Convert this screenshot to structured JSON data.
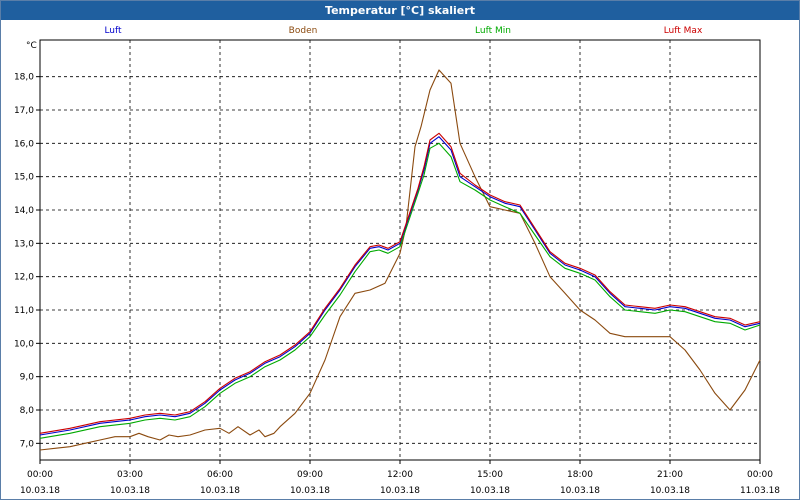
{
  "window": {
    "title": "Temperatur [°C] skaliert"
  },
  "chart_data": {
    "type": "line",
    "unit_label": "°C",
    "title": "Temperatur [°C] skaliert",
    "ylim": [
      6.5,
      19.1
    ],
    "yticks": [
      "7,0",
      "8,0",
      "9,0",
      "10,0",
      "11,0",
      "12,0",
      "13,0",
      "14,0",
      "15,0",
      "16,0",
      "17,0",
      "18,0"
    ],
    "xlim": [
      0,
      24
    ],
    "xticks": [
      {
        "time": "00:00",
        "date": "10.03.18"
      },
      {
        "time": "03:00",
        "date": "10.03.18"
      },
      {
        "time": "06:00",
        "date": "10.03.18"
      },
      {
        "time": "09:00",
        "date": "10.03.18"
      },
      {
        "time": "12:00",
        "date": "10.03.18"
      },
      {
        "time": "15:00",
        "date": "10.03.18"
      },
      {
        "time": "18:00",
        "date": "10.03.18"
      },
      {
        "time": "21:00",
        "date": "10.03.18"
      },
      {
        "time": "00:00",
        "date": "11.03.18"
      }
    ],
    "grid": true,
    "legend_position": "top",
    "series": [
      {
        "name": "Luft",
        "color": "#0000cc",
        "x": [
          0,
          1,
          2,
          3,
          3.5,
          4,
          4.5,
          5,
          5.5,
          6,
          6.5,
          7,
          7.5,
          8,
          8.5,
          9,
          9.5,
          10,
          10.5,
          11,
          11.3,
          11.6,
          12,
          12.3,
          12.6,
          12.8,
          13,
          13.3,
          13.7,
          14,
          14.5,
          15,
          15.5,
          16,
          16.5,
          17,
          17.5,
          18,
          18.5,
          19,
          19.5,
          20,
          20.5,
          21,
          21.5,
          22,
          22.5,
          23,
          23.5,
          24
        ],
        "y": [
          7.25,
          7.4,
          7.6,
          7.7,
          7.8,
          7.85,
          7.8,
          7.9,
          8.2,
          8.6,
          8.9,
          9.1,
          9.4,
          9.6,
          9.9,
          10.3,
          11.0,
          11.6,
          12.3,
          12.85,
          12.9,
          12.8,
          13.0,
          13.8,
          14.6,
          15.2,
          16.0,
          16.2,
          15.8,
          15.0,
          14.7,
          14.4,
          14.2,
          14.1,
          13.4,
          12.7,
          12.35,
          12.2,
          12.0,
          11.5,
          11.1,
          11.05,
          11.0,
          11.1,
          11.05,
          10.9,
          10.75,
          10.7,
          10.5,
          10.6
        ]
      },
      {
        "name": "Boden",
        "color": "#8b4a0f",
        "x": [
          0,
          0.5,
          1,
          1.5,
          2,
          2.5,
          3,
          3.3,
          3.6,
          4,
          4.3,
          4.6,
          5,
          5.5,
          6,
          6.3,
          6.6,
          7,
          7.3,
          7.5,
          7.8,
          8,
          8.5,
          9,
          9.5,
          10,
          10.5,
          11,
          11.5,
          12,
          12.2,
          12.5,
          12.7,
          13,
          13.3,
          13.7,
          14,
          14.5,
          15,
          15.5,
          16,
          16.5,
          17,
          17.5,
          18,
          18.5,
          19,
          19.5,
          20,
          21,
          21.5,
          22,
          22.5,
          23,
          23.5,
          24
        ],
        "y": [
          6.8,
          6.85,
          6.9,
          7.0,
          7.1,
          7.2,
          7.2,
          7.3,
          7.2,
          7.1,
          7.25,
          7.2,
          7.25,
          7.4,
          7.45,
          7.3,
          7.5,
          7.25,
          7.4,
          7.2,
          7.3,
          7.5,
          7.9,
          8.5,
          9.5,
          10.8,
          11.5,
          11.6,
          11.8,
          12.7,
          13.5,
          15.9,
          16.5,
          17.6,
          18.2,
          17.8,
          16.0,
          15.0,
          14.1,
          14.0,
          13.9,
          13.0,
          12.0,
          11.5,
          11.0,
          10.7,
          10.3,
          10.2,
          10.2,
          10.2,
          9.8,
          9.2,
          8.5,
          8.0,
          8.6,
          9.5
        ]
      },
      {
        "name": "Luft Min",
        "color": "#00aa00",
        "x": [
          0,
          1,
          2,
          3,
          3.5,
          4,
          4.5,
          5,
          5.5,
          6,
          6.5,
          7,
          7.5,
          8,
          8.5,
          9,
          9.5,
          10,
          10.5,
          11,
          11.3,
          11.6,
          12,
          12.3,
          12.6,
          12.8,
          13,
          13.3,
          13.7,
          14,
          14.5,
          15,
          15.5,
          16,
          16.5,
          17,
          17.5,
          18,
          18.5,
          19,
          19.5,
          20,
          20.5,
          21,
          21.5,
          22,
          22.5,
          23,
          23.5,
          24
        ],
        "y": [
          7.15,
          7.3,
          7.5,
          7.6,
          7.7,
          7.75,
          7.7,
          7.8,
          8.1,
          8.5,
          8.8,
          9.0,
          9.3,
          9.5,
          9.8,
          10.2,
          10.85,
          11.45,
          12.15,
          12.75,
          12.8,
          12.7,
          12.9,
          13.7,
          14.5,
          15.05,
          15.85,
          16.0,
          15.6,
          14.85,
          14.6,
          14.3,
          14.1,
          13.9,
          13.25,
          12.6,
          12.25,
          12.1,
          11.9,
          11.4,
          11.0,
          10.95,
          10.9,
          11.0,
          10.95,
          10.8,
          10.65,
          10.6,
          10.4,
          10.55
        ]
      },
      {
        "name": "Luft Max",
        "color": "#cc0000",
        "x": [
          0,
          1,
          2,
          3,
          3.5,
          4,
          4.5,
          5,
          5.5,
          6,
          6.5,
          7,
          7.5,
          8,
          8.5,
          9,
          9.5,
          10,
          10.5,
          11,
          11.3,
          11.6,
          12,
          12.3,
          12.6,
          12.8,
          13,
          13.3,
          13.7,
          14,
          14.5,
          15,
          15.5,
          16,
          16.5,
          17,
          17.5,
          18,
          18.5,
          19,
          19.5,
          20,
          20.5,
          21,
          21.5,
          22,
          22.5,
          23,
          23.5,
          24
        ],
        "y": [
          7.3,
          7.45,
          7.65,
          7.75,
          7.85,
          7.9,
          7.85,
          7.95,
          8.25,
          8.65,
          8.95,
          9.15,
          9.45,
          9.65,
          9.95,
          10.35,
          11.05,
          11.65,
          12.35,
          12.9,
          12.95,
          12.85,
          13.05,
          13.85,
          14.65,
          15.3,
          16.1,
          16.3,
          15.9,
          15.1,
          14.75,
          14.45,
          14.25,
          14.15,
          13.45,
          12.75,
          12.4,
          12.25,
          12.05,
          11.55,
          11.15,
          11.1,
          11.05,
          11.15,
          11.1,
          10.95,
          10.8,
          10.75,
          10.55,
          10.65
        ]
      }
    ]
  }
}
